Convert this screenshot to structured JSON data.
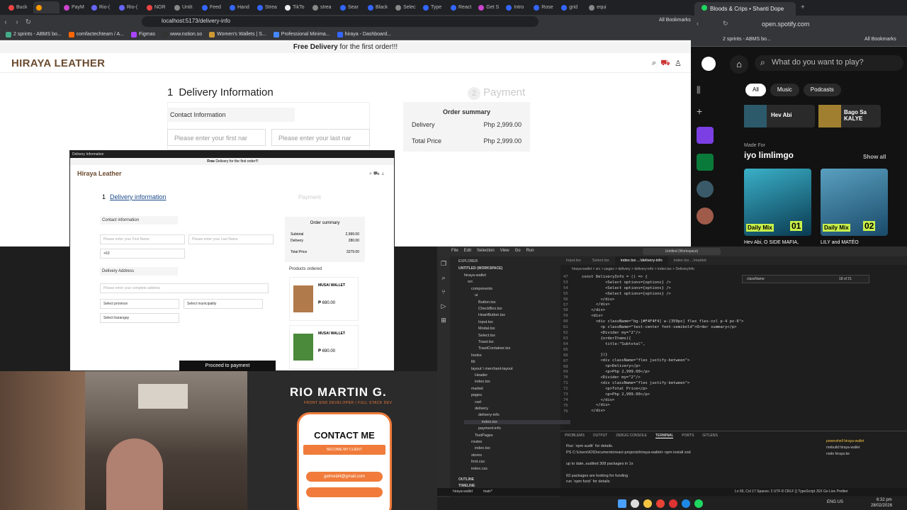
{
  "browser": {
    "tabs": [
      "Buck",
      "",
      "PayM",
      "Rio-(",
      "Rio-(",
      "NOR",
      "Untit",
      "Feed",
      "Hand",
      "Strea",
      "TikTo",
      "strea",
      "Sear",
      "Black",
      "Selec",
      "Type",
      "React",
      "Get S",
      "Intro",
      "Rose",
      "grid",
      "equi"
    ],
    "url": "localhost:5173/delivery-info",
    "bookmarks": [
      "2 sprints - ABMS bo...",
      "comfactechteam / A...",
      "Figmas",
      "www.notion.so",
      "Women's Wallets | S...",
      "Professional Minima...",
      "hiraya - Dashboard..."
    ],
    "all_bookmarks": "All Bookmarks"
  },
  "site": {
    "promo_bold": "Free Delivery",
    "promo_rest": " for the first order!!!",
    "brand": "HIRAYA LEATHER",
    "step1_num": "1",
    "step1_label": "Delivery Information",
    "step2_num": "2",
    "step2_label": "Payment",
    "contact_label": "Contact Information",
    "first_name_placeholder": "Please enter your first nar",
    "last_name_placeholder": "Please enter your last nar",
    "order_title": "Order summary",
    "order_rows": [
      {
        "label": "Delivery",
        "value": "Php 2,999.00"
      },
      {
        "label": "Total Price",
        "value": "Php 2,999.00"
      }
    ]
  },
  "preview": {
    "window_title": "Delivery Information",
    "promo_bold": "Free",
    "promo_rest": " Delivery for the first order!!!",
    "brand": "Hiraya Leather",
    "step1_num": "1",
    "step1_label": "Delivery information",
    "step2_label": "Payment",
    "contact_label": "Contact information",
    "first_placeholder": "Please enter your First Name",
    "last_placeholder": "Please enter your Last Name",
    "phone_prefix": "+63",
    "address_label": "Delivery Address",
    "address_placeholder": "Please enter your complete address",
    "province": "Select province",
    "municipality": "Select municipality",
    "barangay": "Select barangay",
    "order_title": "Order summary",
    "order_rows": [
      {
        "label": "Subtotal",
        "value": "2,999.00"
      },
      {
        "label": "Delivery",
        "value": "280.00"
      },
      {
        "label": "Total Price",
        "value": "3279.00"
      }
    ],
    "products_title": "Products ordered",
    "product1_name": "MUSAI WALLET",
    "product1_price": "₱ 690.00",
    "product2_name": "MUSAI WALLET",
    "product2_price": "₱ 690.00",
    "proceed": "Proceed to payment"
  },
  "portfolio": {
    "name": "RIO MARTIN G.",
    "subtitle": "FRONT END DEVELOPER | FULL STACK DEV",
    "contact": "CONTACT ME",
    "client_btn": "BECOME MY CLIENT",
    "link1": "gelmeid4@gmail.com"
  },
  "spotify": {
    "tab_title": "Bloods & Crips • Shanti Dope",
    "url": "open.spotify.com",
    "bookmark": "2 sprints - ABMS bo...",
    "all_bookmarks": "All Bookmarks",
    "search_placeholder": "What do you want to play?",
    "chips": [
      "All",
      "Music",
      "Podcasts"
    ],
    "card1": "Hev Abi",
    "card2": "Bago Sa KALYE",
    "made_for": "Made For",
    "user": "iyo limlimgo",
    "show_all": "Show all",
    "mix1_label": "Daily Mix",
    "mix1_num": "01",
    "mix2_label": "Daily Mix",
    "mix2_num": "02",
    "mix1_caption": "Hev Abi, O SIDE MAFIA,",
    "mix2_caption": "LILY and MATÉO"
  },
  "vscode": {
    "menu": [
      "File",
      "Edit",
      "Selection",
      "View",
      "Go",
      "Run"
    ],
    "title": "Untitled (Workspace)",
    "explorer": "EXPLORER",
    "workspace": "UNTITLED (WORKSPACE)",
    "tabs": [
      "Input.tsx",
      "Select.tsx",
      "index.tsx ...\\delivery-info",
      "index.tsx ...\\market"
    ],
    "breadcrumb": "hiraya-wallet > src > pages > delivery > delivery-info > index.tsx > DeliveryInfo",
    "find_text": "className",
    "find_count": "18 of 21",
    "files": [
      "hiraya-wallet",
      "src",
      "components",
      "ui",
      "Button.tsx",
      "CheckBox.tsx",
      "HeartButton.tsx",
      "Input.tsx",
      "Modal.tsx",
      "Select.tsx",
      "Toast.tsx",
      "ToastContainer.tsx",
      "hooks",
      "lib",
      "layout \\ merchant-layout",
      "Header",
      "index.tsx",
      "market",
      "pages",
      "cart",
      "delivery",
      "delivery-info",
      "index.tsx",
      "payment-info",
      "TestPages",
      "routes",
      "index.tsx",
      "stores",
      "font.css",
      "index.css"
    ],
    "outline": "OUTLINE",
    "timeline": "TIMELINE",
    "code_lines": [
      "const DeliveryInfo = () => {",
      "          <Select options={options} />",
      "          <Select options={options} />",
      "          <Select options={options} />",
      "        </div>",
      "      </div>",
      "    </div>",
      "    <div>",
      "      <div className=\"bg-[#F4F4F4] w-[350px] flex flex-col p-4 px-6\">",
      "        <p className=\"text-center font-semibold\">Order summary</p>",
      "        <Divider my=\"2\"/>",
      "        {orderItems({",
      "          title:\"Subtotal\",",
      "        ",
      "        })}",
      "        <div className=\"flex justify-between\">",
      "          <p>Delivery</p>",
      "          <p>Php 2,999.00</p>",
      "        <Divider my=\"2\"/>",
      "        <div className=\"flex justify-between\">",
      "          <p>Total Price</p>",
      "          <p>Php 2,999.00</p>",
      "        </div>",
      "      </div>",
      "    </div>"
    ],
    "line_numbers": [
      "47",
      "53",
      "54",
      "55",
      "56",
      "57",
      "58",
      "59",
      "60",
      "61",
      "62",
      "63",
      "64",
      "65",
      "66",
      "67",
      "68",
      "69",
      "70",
      "71",
      "72",
      "73",
      "74",
      "75",
      "76"
    ],
    "panel_tabs": [
      "PROBLEMS",
      "OUTPUT",
      "DEBUG CONSOLE",
      "TERMINAL",
      "PORTS",
      "GITLENS"
    ],
    "terminal_lines": [
      "Run `npm audit` for details.",
      "PS C:\\Users\\IO\\Documents\\react-projects\\hiraya-wallet> npm install zod",
      "",
      "up to date, audited 308 packages in 1s",
      "",
      "63 packages are looking for funding",
      "  run `npm fund` for details"
    ],
    "terminals": [
      "powershell hiraya-wallet",
      "nrebuild hiraya-wallet",
      "node hiraya be"
    ],
    "status_left": "hiraya-wallet",
    "status_branch": "main*",
    "status_right": "Ln 65, Col 17   Spaces: 2   UTF-8   CRLF   {} TypeScript JSX   Go Live   Prettier",
    "clock_time": "6:32 pm",
    "clock_date": "28/02/2026",
    "lang": "ENG US"
  },
  "colors": {
    "brand": "#6b4b2f",
    "accent": "#f07b3b",
    "spotify_green": "#1ed760"
  }
}
